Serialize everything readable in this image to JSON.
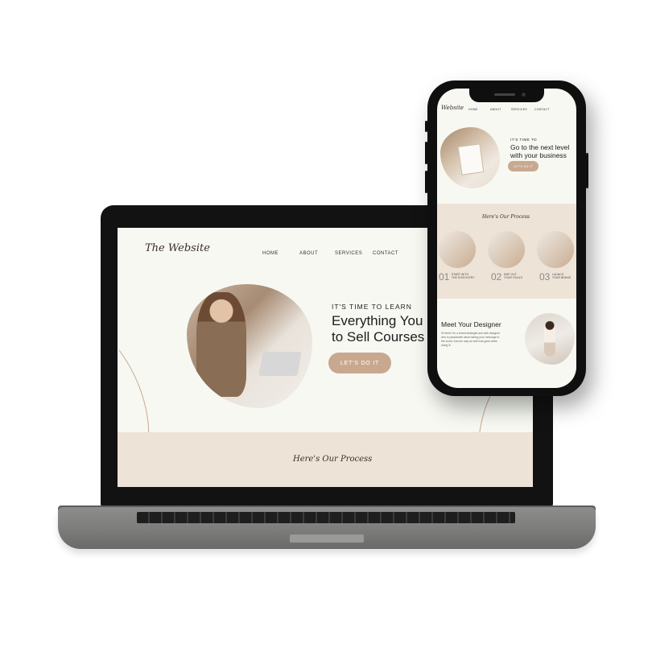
{
  "laptop": {
    "logo": "The Website",
    "nav": [
      "HOME",
      "ABOUT",
      "SERVICES",
      "CONTACT"
    ],
    "hero_kicker": "IT'S TIME TO LEARN",
    "hero_title_line1": "Everything You",
    "hero_title_line2": "to Sell Courses",
    "hero_button": "LET'S DO IT",
    "process_title": "Here's Our Process"
  },
  "phone": {
    "logo": "Website",
    "nav": [
      "HOME",
      "ABOUT",
      "SERVICES",
      "CONTACT"
    ],
    "hero_kicker": "IT'S TIME TO",
    "hero_title_line1": "Go to the next level",
    "hero_title_line2": "with your business",
    "hero_button": "LET'S DO IT",
    "process_title": "Here's Our Process",
    "steps": [
      {
        "num": "01",
        "label_line1": "START WITH",
        "label_line2": "THE DISCOVERY"
      },
      {
        "num": "02",
        "label_line1": "MAP OUT",
        "label_line2": "YOUR GOALS"
      },
      {
        "num": "03",
        "label_line1": "LAUNCH",
        "label_line2": "YOUR BRAND"
      }
    ],
    "meet_title": "Meet Your Designer",
    "meet_text": "Hi there! I'm a brand strategist and web designer who is passionate about taking your message to the world. And we may as well look good while doing it!"
  },
  "colors": {
    "accent": "#c9a890",
    "band": "#ede3d7",
    "background": "#f7f8f2"
  }
}
